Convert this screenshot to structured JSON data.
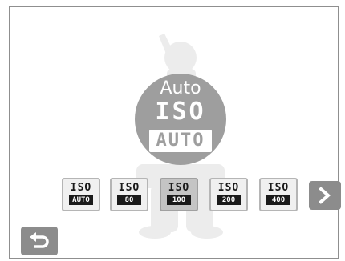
{
  "iso_display": {
    "mode_label": "Auto",
    "iso_text": "ISO",
    "value_text": "AUTO"
  },
  "iso_options": [
    {
      "iso": "ISO",
      "value": "AUTO"
    },
    {
      "iso": "ISO",
      "value": "80"
    },
    {
      "iso": "ISO",
      "value": "100"
    },
    {
      "iso": "ISO",
      "value": "200"
    },
    {
      "iso": "ISO",
      "value": "400"
    }
  ],
  "selected_option": "100",
  "icons": {
    "next": "chevron-right-icon",
    "back": "return-arrow-icon",
    "background": "person-silhouette"
  },
  "colors": {
    "circle": "#9e9e9e",
    "button_bg": "#8c8c8c",
    "silhouette": "#ececec"
  }
}
